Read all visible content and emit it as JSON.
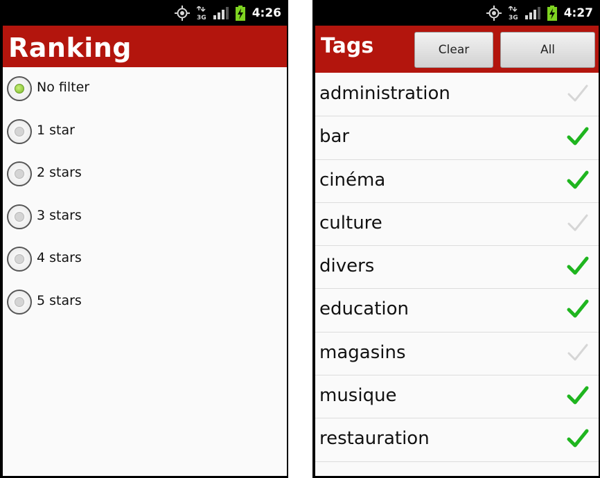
{
  "left": {
    "status": {
      "time": "4:26"
    },
    "title": "Ranking",
    "options": [
      {
        "label": "No filter",
        "checked": true
      },
      {
        "label": "1 star",
        "checked": false
      },
      {
        "label": "2 stars",
        "checked": false
      },
      {
        "label": "3 stars",
        "checked": false
      },
      {
        "label": "4 stars",
        "checked": false
      },
      {
        "label": "5 stars",
        "checked": false
      }
    ]
  },
  "right": {
    "status": {
      "time": "4:27"
    },
    "title": "Tags",
    "clear_label": "Clear",
    "all_label": "All",
    "tags": [
      {
        "label": "administration",
        "checked": false
      },
      {
        "label": "bar",
        "checked": true
      },
      {
        "label": "cinéma",
        "checked": true
      },
      {
        "label": "culture",
        "checked": false
      },
      {
        "label": "divers",
        "checked": true
      },
      {
        "label": "education",
        "checked": true
      },
      {
        "label": "magasins",
        "checked": false
      },
      {
        "label": "musique",
        "checked": true
      },
      {
        "label": "restauration",
        "checked": true
      }
    ]
  },
  "colors": {
    "title_bar": "#b3150d",
    "check_on": "#1fb51f",
    "check_off": "#d6d6d6",
    "radio_selected": "#7ab828"
  },
  "icons": [
    "gps-icon",
    "3g-icon",
    "signal-icon",
    "battery-charging-icon",
    "radio-button",
    "checkmark-icon"
  ]
}
